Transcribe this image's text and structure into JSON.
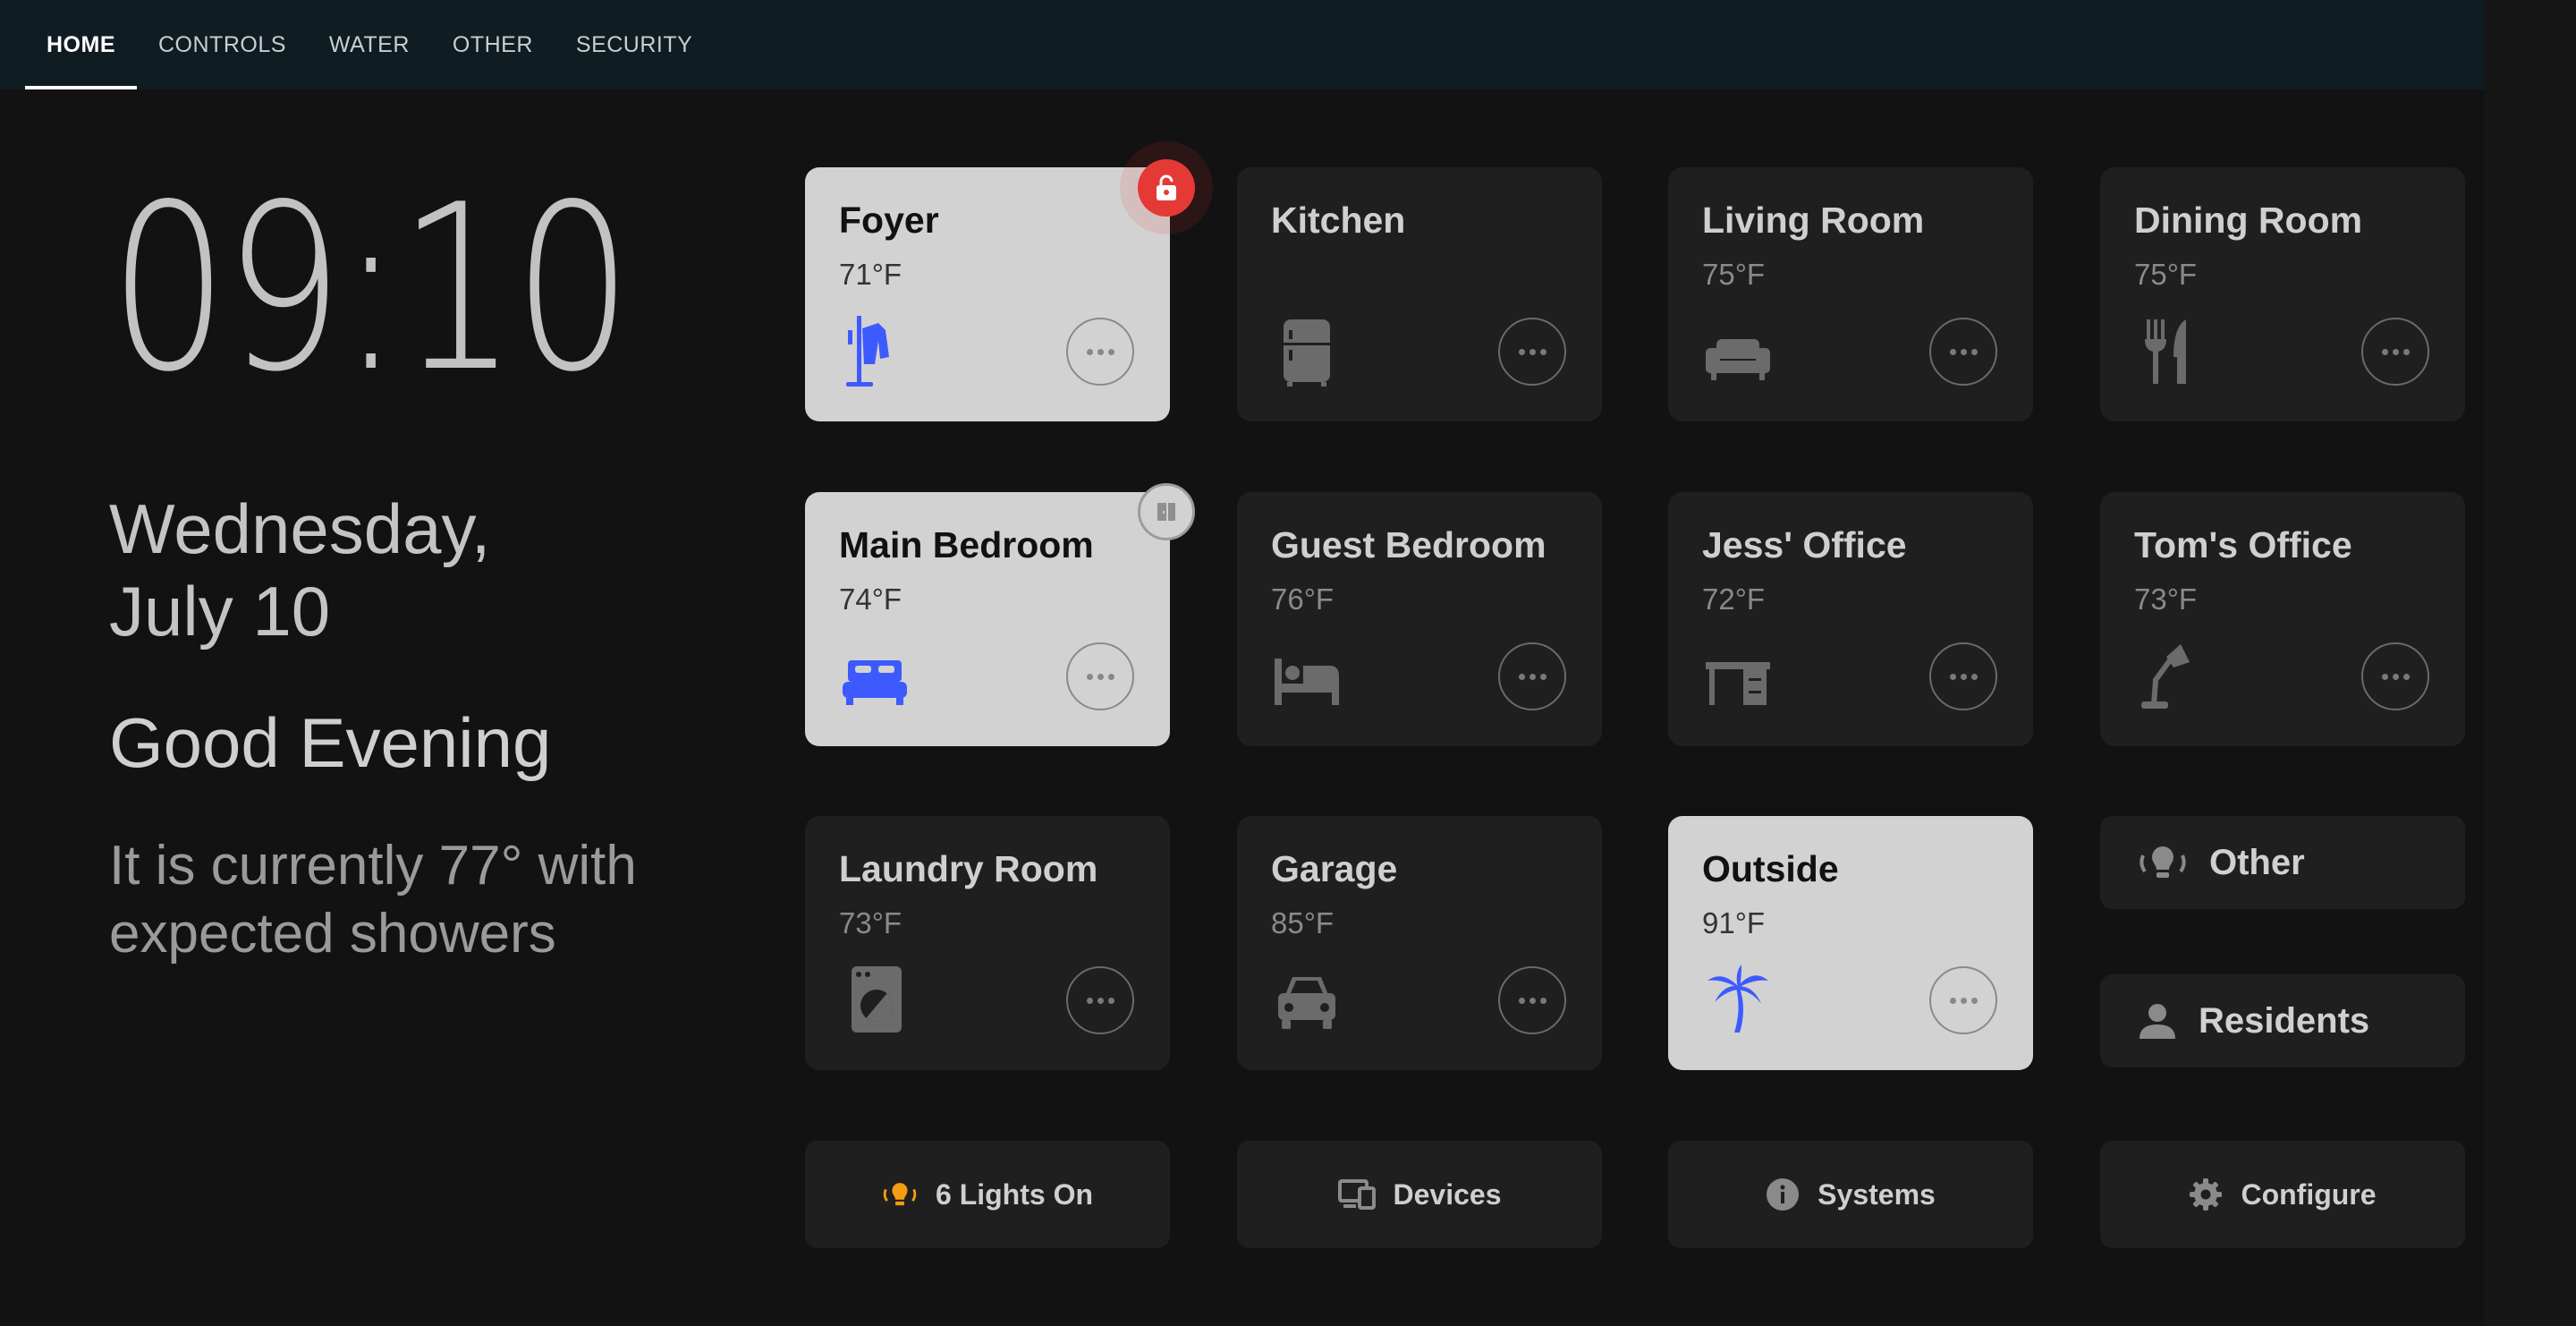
{
  "nav": {
    "tabs": [
      {
        "label": "HOME",
        "active": true
      },
      {
        "label": "CONTROLS"
      },
      {
        "label": "WATER"
      },
      {
        "label": "OTHER"
      },
      {
        "label": "SECURITY"
      }
    ]
  },
  "clock": {
    "time": "09:10"
  },
  "date": {
    "line1": "Wednesday,",
    "line2": "July 10"
  },
  "greeting": "Good Evening",
  "weather": {
    "line1": "It is currently 77° with",
    "line2": "expected showers"
  },
  "rooms": [
    {
      "name": "Foyer",
      "temp": "71°F",
      "icon": "coat-rack-icon",
      "active": true,
      "badge": "unlocked-lock-icon"
    },
    {
      "name": "Kitchen",
      "temp": "",
      "icon": "fridge-icon",
      "active": false
    },
    {
      "name": "Living Room",
      "temp": "75°F",
      "icon": "sofa-icon",
      "active": false
    },
    {
      "name": "Dining Room",
      "temp": "75°F",
      "icon": "fork-knife-icon",
      "active": false
    },
    {
      "name": "Main Bedroom",
      "temp": "74°F",
      "icon": "bed-double-icon",
      "active": true,
      "badge": "door-icon"
    },
    {
      "name": "Guest Bedroom",
      "temp": "76°F",
      "icon": "bed-icon",
      "active": false
    },
    {
      "name": "Jess' Office",
      "temp": "72°F",
      "icon": "desk-icon",
      "active": false
    },
    {
      "name": "Tom's Office",
      "temp": "73°F",
      "icon": "desk-lamp-icon",
      "active": false
    },
    {
      "name": "Laundry Room",
      "temp": "73°F",
      "icon": "washing-machine-icon",
      "active": false
    },
    {
      "name": "Garage",
      "temp": "85°F",
      "icon": "car-icon",
      "active": false
    },
    {
      "name": "Outside",
      "temp": "91°F",
      "icon": "palm-tree-icon",
      "active": true
    }
  ],
  "side_buttons": {
    "other": "Other",
    "residents": "Residents"
  },
  "bottom_buttons": {
    "lights": "6 Lights On",
    "devices": "Devices",
    "systems": "Systems",
    "configure": "Configure"
  },
  "colors": {
    "accent_blue": "#3d5afe",
    "icon_grey": "#6b6b6b",
    "alert_red": "#e53935",
    "lights_orange": "#f39c12"
  }
}
